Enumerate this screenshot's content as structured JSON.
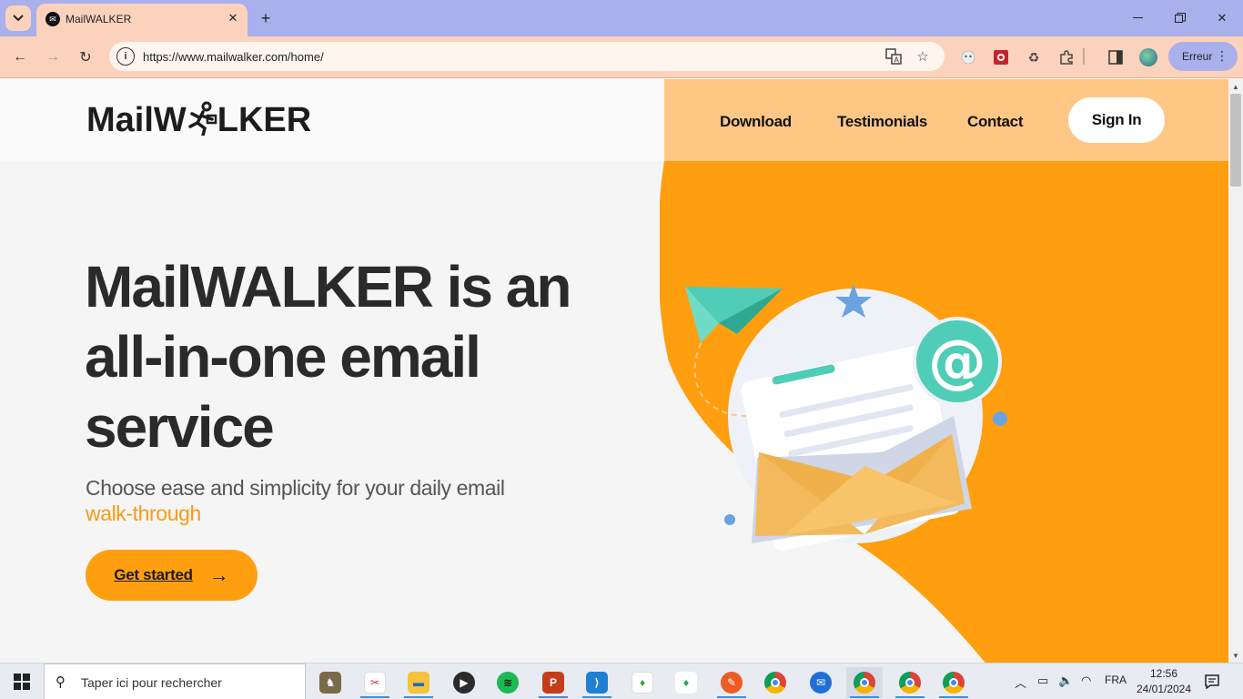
{
  "browser": {
    "tab_title": "MailWALKER",
    "url": "https://www.mailwalker.com/home/",
    "profile_status": "Erreur",
    "window_controls": [
      "minimize-icon",
      "restore-icon",
      "close-icon"
    ]
  },
  "site": {
    "logo_text_left": "MailW",
    "logo_text_right": "LKER",
    "nav": {
      "download": "Download",
      "testimonials": "Testimonials",
      "contact": "Contact",
      "signin": "Sign In"
    },
    "hero": {
      "title_line1": "MailWALKER is an",
      "title_line2": "all-in-one email",
      "title_line3": "service",
      "subtitle": "Choose ease and simplicity for your daily email",
      "accent": "walk-through",
      "cta": "Get started"
    },
    "colors": {
      "orange": "#ff9f0f",
      "peach": "#ffc785",
      "accent_text": "#f79c14",
      "teal": "#4fcdb6"
    },
    "illustration_icons": [
      "paper-plane-icon",
      "star-icon",
      "at-sign-icon",
      "envelope-icon"
    ]
  },
  "taskbar": {
    "search_placeholder": "Taper ici pour rechercher",
    "language": "FRA",
    "time": "12:56",
    "date": "24/01/2024"
  }
}
